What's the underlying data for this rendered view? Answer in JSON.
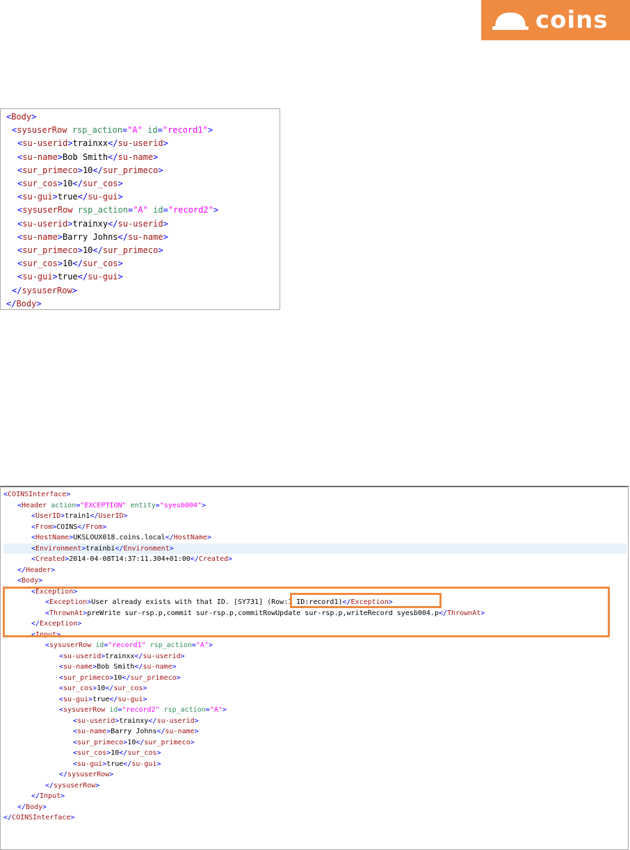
{
  "brand": {
    "name": "coins",
    "color": "#ef8a41",
    "icon": "hard-hat-icon"
  },
  "request_xml": [
    {
      "indent": 0,
      "parts": [
        [
          "b",
          "<"
        ],
        [
          "t",
          "Body"
        ],
        [
          "b",
          ">"
        ]
      ]
    },
    {
      "indent": 1,
      "parts": [
        [
          "b",
          "<"
        ],
        [
          "t",
          "sysuserRow"
        ],
        [
          "x",
          " "
        ],
        [
          "a",
          "rsp_action"
        ],
        [
          "b",
          "="
        ],
        [
          "v",
          "\"A\""
        ],
        [
          "x",
          " "
        ],
        [
          "a",
          "id"
        ],
        [
          "b",
          "="
        ],
        [
          "v",
          "\"record1\""
        ],
        [
          "b",
          ">"
        ]
      ]
    },
    {
      "indent": 2,
      "parts": [
        [
          "b",
          "<"
        ],
        [
          "t",
          "su-userid"
        ],
        [
          "b",
          ">"
        ],
        [
          "x",
          "trainxx"
        ],
        [
          "b",
          "</"
        ],
        [
          "t",
          "su-userid"
        ],
        [
          "b",
          ">"
        ]
      ]
    },
    {
      "indent": 2,
      "parts": [
        [
          "b",
          "<"
        ],
        [
          "t",
          "su-name"
        ],
        [
          "b",
          ">"
        ],
        [
          "x",
          "Bob Smith"
        ],
        [
          "b",
          "</"
        ],
        [
          "t",
          "su-name"
        ],
        [
          "b",
          ">"
        ]
      ]
    },
    {
      "indent": 2,
      "parts": [
        [
          "b",
          "<"
        ],
        [
          "t",
          "sur_primeco"
        ],
        [
          "b",
          ">"
        ],
        [
          "x",
          "10"
        ],
        [
          "b",
          "</"
        ],
        [
          "t",
          "sur_primeco"
        ],
        [
          "b",
          ">"
        ]
      ]
    },
    {
      "indent": 2,
      "parts": [
        [
          "b",
          "<"
        ],
        [
          "t",
          "sur_cos"
        ],
        [
          "b",
          ">"
        ],
        [
          "x",
          "10"
        ],
        [
          "b",
          "</"
        ],
        [
          "t",
          "sur_cos"
        ],
        [
          "b",
          ">"
        ]
      ]
    },
    {
      "indent": 2,
      "parts": [
        [
          "b",
          "<"
        ],
        [
          "t",
          "su-gui"
        ],
        [
          "b",
          ">"
        ],
        [
          "x",
          "true"
        ],
        [
          "b",
          "</"
        ],
        [
          "t",
          "su-gui"
        ],
        [
          "b",
          ">"
        ]
      ]
    },
    {
      "indent": 2,
      "parts": [
        [
          "b",
          "<"
        ],
        [
          "t",
          "sysuserRow"
        ],
        [
          "x",
          " "
        ],
        [
          "a",
          "rsp_action"
        ],
        [
          "b",
          "="
        ],
        [
          "v",
          "\"A\""
        ],
        [
          "x",
          " "
        ],
        [
          "a",
          "id"
        ],
        [
          "b",
          "="
        ],
        [
          "v",
          "\"record2\""
        ],
        [
          "b",
          ">"
        ]
      ]
    },
    {
      "indent": 2,
      "parts": [
        [
          "b",
          "<"
        ],
        [
          "t",
          "su-userid"
        ],
        [
          "b",
          ">"
        ],
        [
          "x",
          "trainxy"
        ],
        [
          "b",
          "</"
        ],
        [
          "t",
          "su-userid"
        ],
        [
          "b",
          ">"
        ]
      ]
    },
    {
      "indent": 2,
      "parts": [
        [
          "b",
          "<"
        ],
        [
          "t",
          "su-name"
        ],
        [
          "b",
          ">"
        ],
        [
          "x",
          "Barry Johns"
        ],
        [
          "b",
          "</"
        ],
        [
          "t",
          "su-name"
        ],
        [
          "b",
          ">"
        ]
      ]
    },
    {
      "indent": 2,
      "parts": [
        [
          "b",
          "<"
        ],
        [
          "t",
          "sur_primeco"
        ],
        [
          "b",
          ">"
        ],
        [
          "x",
          "10"
        ],
        [
          "b",
          "</"
        ],
        [
          "t",
          "sur_primeco"
        ],
        [
          "b",
          ">"
        ]
      ]
    },
    {
      "indent": 2,
      "parts": [
        [
          "b",
          "<"
        ],
        [
          "t",
          "sur_cos"
        ],
        [
          "b",
          ">"
        ],
        [
          "x",
          "10"
        ],
        [
          "b",
          "</"
        ],
        [
          "t",
          "sur_cos"
        ],
        [
          "b",
          ">"
        ]
      ]
    },
    {
      "indent": 2,
      "parts": [
        [
          "b",
          "<"
        ],
        [
          "t",
          "su-gui"
        ],
        [
          "b",
          ">"
        ],
        [
          "x",
          "true"
        ],
        [
          "b",
          "</"
        ],
        [
          "t",
          "su-gui"
        ],
        [
          "b",
          ">"
        ]
      ]
    },
    {
      "indent": 1,
      "parts": [
        [
          "b",
          "</"
        ],
        [
          "t",
          "sysuserRow"
        ],
        [
          "b",
          ">"
        ]
      ]
    },
    {
      "indent": 0,
      "parts": [
        [
          "b",
          "</"
        ],
        [
          "t",
          "Body"
        ],
        [
          "b",
          ">"
        ]
      ]
    }
  ],
  "response_xml": [
    {
      "indent": 0,
      "parts": [
        [
          "b",
          "<"
        ],
        [
          "t",
          "COINSInterface"
        ],
        [
          "b",
          ">"
        ]
      ]
    },
    {
      "indent": 1,
      "parts": [
        [
          "b",
          "<"
        ],
        [
          "t",
          "Header"
        ],
        [
          "x",
          " "
        ],
        [
          "a",
          "action"
        ],
        [
          "b",
          "="
        ],
        [
          "v",
          "\"EXCEPTION\""
        ],
        [
          "x",
          " "
        ],
        [
          "a",
          "entity"
        ],
        [
          "b",
          "="
        ],
        [
          "v",
          "\"syesb004\""
        ],
        [
          "b",
          ">"
        ]
      ]
    },
    {
      "indent": 2,
      "parts": [
        [
          "b",
          "<"
        ],
        [
          "t",
          "UserID"
        ],
        [
          "b",
          ">"
        ],
        [
          "x",
          "train1"
        ],
        [
          "b",
          "</"
        ],
        [
          "t",
          "UserID"
        ],
        [
          "b",
          ">"
        ]
      ]
    },
    {
      "indent": 2,
      "parts": [
        [
          "b",
          "<"
        ],
        [
          "t",
          "From"
        ],
        [
          "b",
          ">"
        ],
        [
          "x",
          "COINS"
        ],
        [
          "b",
          "</"
        ],
        [
          "t",
          "From"
        ],
        [
          "b",
          ">"
        ]
      ]
    },
    {
      "indent": 2,
      "parts": [
        [
          "b",
          "<"
        ],
        [
          "t",
          "HostName"
        ],
        [
          "b",
          ">"
        ],
        [
          "x",
          "UKSLOUX018.coins.local"
        ],
        [
          "b",
          "</"
        ],
        [
          "t",
          "HostName"
        ],
        [
          "b",
          ">"
        ]
      ]
    },
    {
      "indent": 2,
      "parts": [
        [
          "b",
          "<"
        ],
        [
          "t",
          "Environment"
        ],
        [
          "b",
          ">"
        ],
        [
          "x",
          "trainbi"
        ],
        [
          "b",
          "</"
        ],
        [
          "t",
          "Environment"
        ],
        [
          "b",
          ">"
        ]
      ]
    },
    {
      "indent": 2,
      "parts": [
        [
          "b",
          "<"
        ],
        [
          "t",
          "Created"
        ],
        [
          "b",
          ">"
        ],
        [
          "x",
          "2014-04-08T14:37:11.304+01:00"
        ],
        [
          "b",
          "</"
        ],
        [
          "t",
          "Created"
        ],
        [
          "b",
          ">"
        ]
      ]
    },
    {
      "indent": 1,
      "parts": [
        [
          "b",
          "</"
        ],
        [
          "t",
          "Header"
        ],
        [
          "b",
          ">"
        ]
      ]
    },
    {
      "indent": 1,
      "parts": [
        [
          "b",
          "<"
        ],
        [
          "t",
          "Body"
        ],
        [
          "b",
          ">"
        ]
      ]
    },
    {
      "indent": 2,
      "parts": [
        [
          "b",
          "<"
        ],
        [
          "t",
          "Exception"
        ],
        [
          "b",
          ">"
        ]
      ]
    },
    {
      "indent": 3,
      "parts": [
        [
          "b",
          "<"
        ],
        [
          "t",
          "Exception"
        ],
        [
          "b",
          ">"
        ],
        [
          "x",
          "User already exists with that ID. [SY731] (Row:1 ID:record1)"
        ],
        [
          "b",
          "</"
        ],
        [
          "t",
          "Exception"
        ],
        [
          "b",
          ">"
        ]
      ]
    },
    {
      "indent": 3,
      "parts": [
        [
          "b",
          "<"
        ],
        [
          "t",
          "ThrownAt"
        ],
        [
          "b",
          ">"
        ],
        [
          "x",
          "preWrite sur-rsp.p,commit sur-rsp.p,commitRowUpdate sur-rsp.p,writeRecord syesb004.p"
        ],
        [
          "b",
          "</"
        ],
        [
          "t",
          "ThrownAt"
        ],
        [
          "b",
          ">"
        ]
      ]
    },
    {
      "indent": 2,
      "parts": [
        [
          "b",
          "</"
        ],
        [
          "t",
          "Exception"
        ],
        [
          "b",
          ">"
        ]
      ]
    },
    {
      "indent": 2,
      "parts": [
        [
          "b",
          "<"
        ],
        [
          "t",
          "Input"
        ],
        [
          "b",
          ">"
        ]
      ]
    },
    {
      "indent": 3,
      "parts": [
        [
          "b",
          "<"
        ],
        [
          "t",
          "sysuserRow"
        ],
        [
          "x",
          " "
        ],
        [
          "a",
          "id"
        ],
        [
          "b",
          "="
        ],
        [
          "v",
          "\"record1\""
        ],
        [
          "x",
          " "
        ],
        [
          "a",
          "rsp_action"
        ],
        [
          "b",
          "="
        ],
        [
          "v",
          "\"A\""
        ],
        [
          "b",
          ">"
        ]
      ]
    },
    {
      "indent": 4,
      "parts": [
        [
          "b",
          "<"
        ],
        [
          "t",
          "su-userid"
        ],
        [
          "b",
          ">"
        ],
        [
          "x",
          "trainxx"
        ],
        [
          "b",
          "</"
        ],
        [
          "t",
          "su-userid"
        ],
        [
          "b",
          ">"
        ]
      ]
    },
    {
      "indent": 4,
      "parts": [
        [
          "b",
          "<"
        ],
        [
          "t",
          "su-name"
        ],
        [
          "b",
          ">"
        ],
        [
          "x",
          "Bob Smith"
        ],
        [
          "b",
          "</"
        ],
        [
          "t",
          "su-name"
        ],
        [
          "b",
          ">"
        ]
      ]
    },
    {
      "indent": 4,
      "parts": [
        [
          "b",
          "<"
        ],
        [
          "t",
          "sur_primeco"
        ],
        [
          "b",
          ">"
        ],
        [
          "x",
          "10"
        ],
        [
          "b",
          "</"
        ],
        [
          "t",
          "sur_primeco"
        ],
        [
          "b",
          ">"
        ]
      ]
    },
    {
      "indent": 4,
      "parts": [
        [
          "b",
          "<"
        ],
        [
          "t",
          "sur_cos"
        ],
        [
          "b",
          ">"
        ],
        [
          "x",
          "10"
        ],
        [
          "b",
          "</"
        ],
        [
          "t",
          "sur_cos"
        ],
        [
          "b",
          ">"
        ]
      ]
    },
    {
      "indent": 4,
      "parts": [
        [
          "b",
          "<"
        ],
        [
          "t",
          "su-gui"
        ],
        [
          "b",
          ">"
        ],
        [
          "x",
          "true"
        ],
        [
          "b",
          "</"
        ],
        [
          "t",
          "su-gui"
        ],
        [
          "b",
          ">"
        ]
      ]
    },
    {
      "indent": 4,
      "parts": [
        [
          "b",
          "<"
        ],
        [
          "t",
          "sysuserRow"
        ],
        [
          "x",
          " "
        ],
        [
          "a",
          "id"
        ],
        [
          "b",
          "="
        ],
        [
          "v",
          "\"record2\""
        ],
        [
          "x",
          " "
        ],
        [
          "a",
          "rsp_action"
        ],
        [
          "b",
          "="
        ],
        [
          "v",
          "\"A\""
        ],
        [
          "b",
          ">"
        ]
      ]
    },
    {
      "indent": 5,
      "parts": [
        [
          "b",
          "<"
        ],
        [
          "t",
          "su-userid"
        ],
        [
          "b",
          ">"
        ],
        [
          "x",
          "trainxy"
        ],
        [
          "b",
          "</"
        ],
        [
          "t",
          "su-userid"
        ],
        [
          "b",
          ">"
        ]
      ]
    },
    {
      "indent": 5,
      "parts": [
        [
          "b",
          "<"
        ],
        [
          "t",
          "su-name"
        ],
        [
          "b",
          ">"
        ],
        [
          "x",
          "Barry Johns"
        ],
        [
          "b",
          "</"
        ],
        [
          "t",
          "su-name"
        ],
        [
          "b",
          ">"
        ]
      ]
    },
    {
      "indent": 5,
      "parts": [
        [
          "b",
          "<"
        ],
        [
          "t",
          "sur_primeco"
        ],
        [
          "b",
          ">"
        ],
        [
          "x",
          "10"
        ],
        [
          "b",
          "</"
        ],
        [
          "t",
          "sur_primeco"
        ],
        [
          "b",
          ">"
        ]
      ]
    },
    {
      "indent": 5,
      "parts": [
        [
          "b",
          "<"
        ],
        [
          "t",
          "sur_cos"
        ],
        [
          "b",
          ">"
        ],
        [
          "x",
          "10"
        ],
        [
          "b",
          "</"
        ],
        [
          "t",
          "sur_cos"
        ],
        [
          "b",
          ">"
        ]
      ]
    },
    {
      "indent": 5,
      "parts": [
        [
          "b",
          "<"
        ],
        [
          "t",
          "su-gui"
        ],
        [
          "b",
          ">"
        ],
        [
          "x",
          "true"
        ],
        [
          "b",
          "</"
        ],
        [
          "t",
          "su-gui"
        ],
        [
          "b",
          ">"
        ]
      ]
    },
    {
      "indent": 4,
      "parts": [
        [
          "b",
          "</"
        ],
        [
          "t",
          "sysuserRow"
        ],
        [
          "b",
          ">"
        ]
      ]
    },
    {
      "indent": 3,
      "parts": [
        [
          "b",
          "</"
        ],
        [
          "t",
          "sysuserRow"
        ],
        [
          "b",
          ">"
        ]
      ]
    },
    {
      "indent": 2,
      "parts": [
        [
          "b",
          "</"
        ],
        [
          "t",
          "Input"
        ],
        [
          "b",
          ">"
        ]
      ]
    },
    {
      "indent": 1,
      "parts": [
        [
          "b",
          "</"
        ],
        [
          "t",
          "Body"
        ],
        [
          "b",
          ">"
        ]
      ]
    },
    {
      "indent": 0,
      "parts": [
        [
          "b",
          "</"
        ],
        [
          "t",
          "COINSInterface"
        ],
        [
          "b",
          ">"
        ]
      ]
    }
  ]
}
